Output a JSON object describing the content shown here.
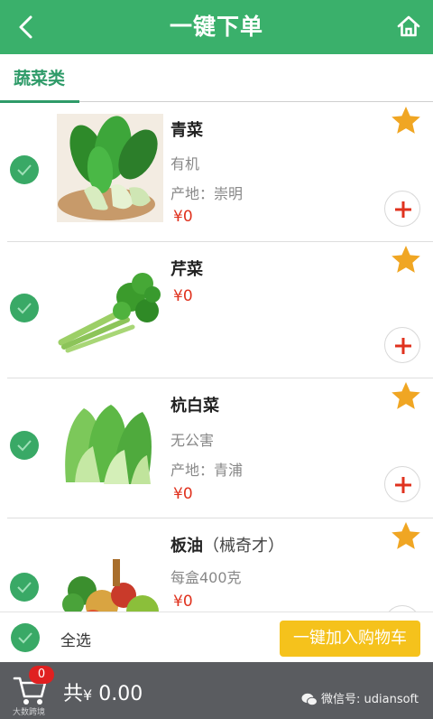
{
  "header": {
    "title": "一键下单"
  },
  "tabs": [
    {
      "label": "蔬菜类"
    }
  ],
  "products": [
    {
      "name": "青菜",
      "alias": "",
      "lines": [
        "有机",
        "产地：崇明"
      ],
      "price": "¥0"
    },
    {
      "name": "芹菜",
      "alias": "",
      "lines": [],
      "price": "¥0"
    },
    {
      "name": "杭白菜",
      "alias": "",
      "lines": [
        "无公害",
        "产地：青浦"
      ],
      "price": "¥0"
    },
    {
      "name": "板油",
      "alias": "（械奇才）",
      "lines": [
        "每盒400克"
      ],
      "price": "¥0"
    }
  ],
  "bottom_bar": {
    "select_all": "全选",
    "add_all_button": "一键加入购物车"
  },
  "footer": {
    "cart_badge": "0",
    "total_prefix": "共",
    "currency": "¥",
    "total": "0.00",
    "watermark_small": "大数跨境",
    "watermark": "微信号: udiansoft"
  },
  "colors": {
    "brand_green": "#3ab06b",
    "price_red": "#e0321e",
    "button_yellow": "#f5c21c",
    "footer_gray": "#5a5c60"
  }
}
